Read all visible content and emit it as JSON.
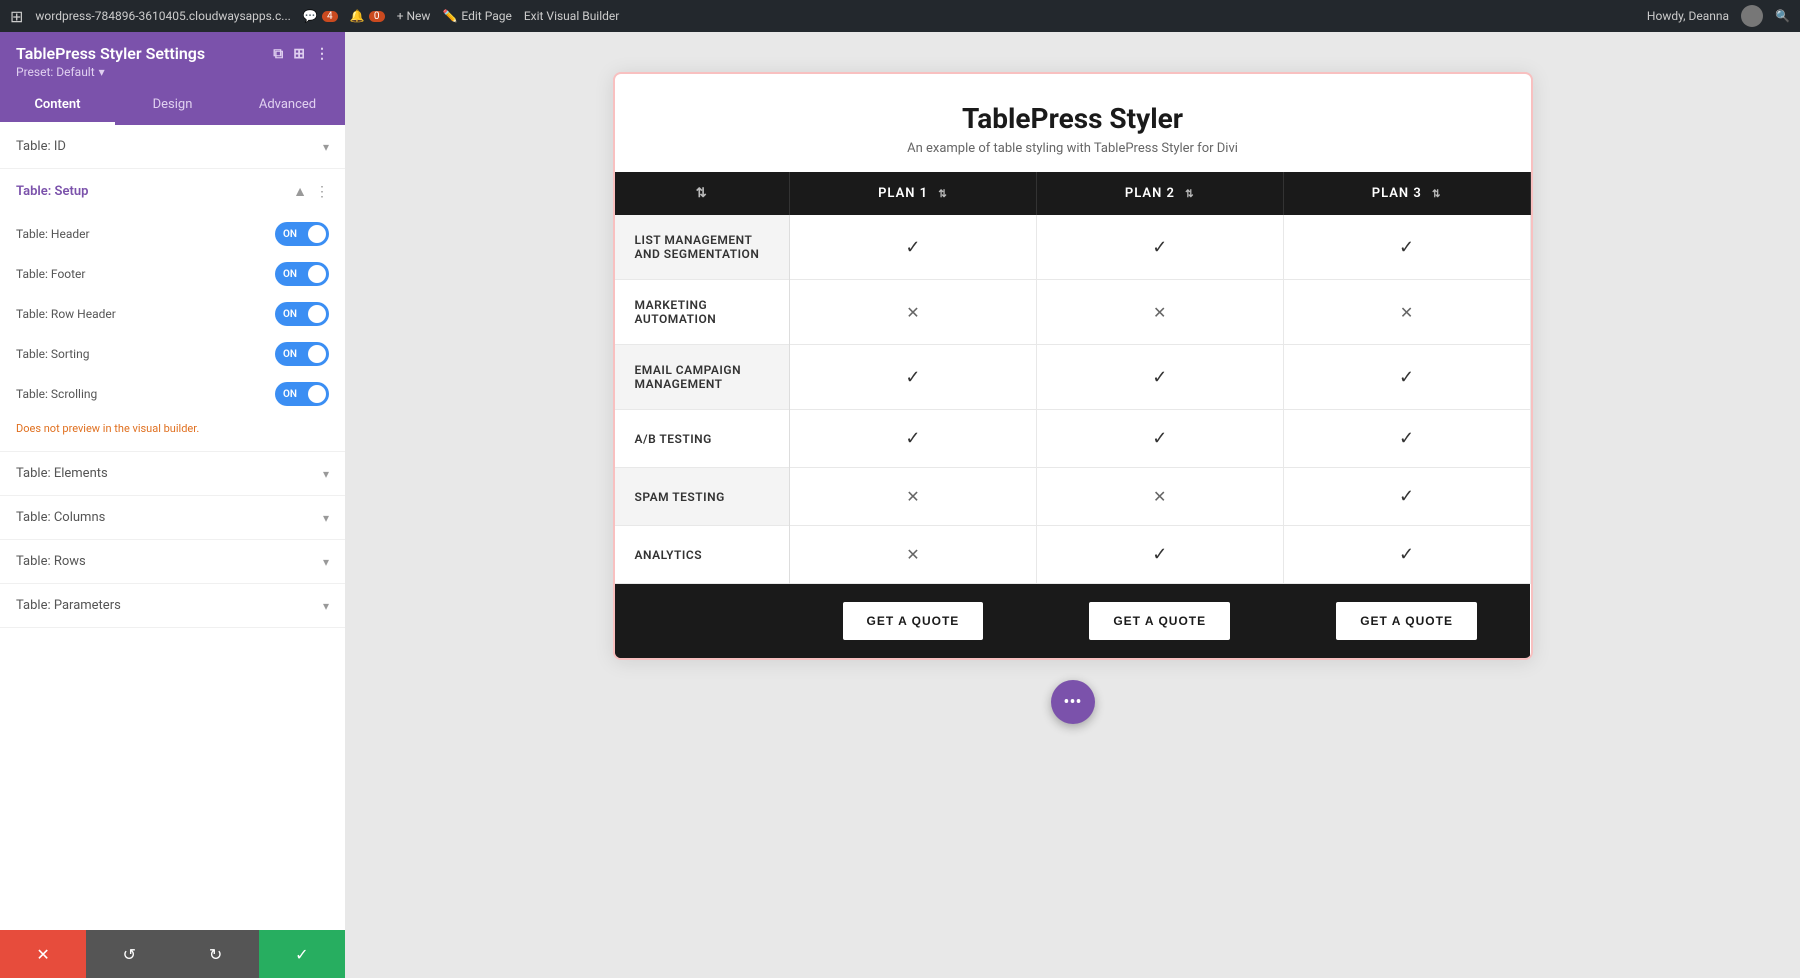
{
  "admin_bar": {
    "wp_logo": "⊞",
    "url": "wordpress-784896-3610405.cloudwaysapps.c...",
    "comments_count": "4",
    "notifications_count": "0",
    "new_label": "+ New",
    "edit_page_label": "Edit Page",
    "exit_builder_label": "Exit Visual Builder",
    "user_label": "Howdy, Deanna",
    "search_icon": "🔍"
  },
  "sidebar": {
    "title": "TablePress Styler Settings",
    "preset_label": "Preset: Default",
    "preset_chevron": "▾",
    "icons": {
      "copy": "⧉",
      "grid": "⊞",
      "menu": "⋮"
    },
    "tabs": [
      {
        "id": "content",
        "label": "Content",
        "active": true
      },
      {
        "id": "design",
        "label": "Design",
        "active": false
      },
      {
        "id": "advanced",
        "label": "Advanced",
        "active": false
      }
    ],
    "sections": [
      {
        "id": "table-id",
        "label": "Table: ID",
        "expanded": false,
        "purple": false
      },
      {
        "id": "table-setup",
        "label": "Table: Setup",
        "expanded": true,
        "purple": true,
        "toggles": [
          {
            "id": "table-header",
            "label": "Table: Header",
            "on": true
          },
          {
            "id": "table-footer",
            "label": "Table: Footer",
            "on": true
          },
          {
            "id": "table-row-header",
            "label": "Table: Row Header",
            "on": true
          },
          {
            "id": "table-sorting",
            "label": "Table: Sorting",
            "on": true
          },
          {
            "id": "table-scrolling",
            "label": "Table: Scrolling",
            "on": true
          }
        ],
        "warning": "Does not preview in the visual builder."
      },
      {
        "id": "table-elements",
        "label": "Table: Elements",
        "expanded": false,
        "purple": false
      },
      {
        "id": "table-columns",
        "label": "Table: Columns",
        "expanded": false,
        "purple": false
      },
      {
        "id": "table-rows",
        "label": "Table: Rows",
        "expanded": false,
        "purple": false
      },
      {
        "id": "table-parameters",
        "label": "Table: Parameters",
        "expanded": false,
        "purple": false
      }
    ]
  },
  "action_bar": {
    "close_icon": "✕",
    "undo_icon": "↺",
    "redo_icon": "↻",
    "save_icon": "✓"
  },
  "main_content": {
    "table_title": "TablePress Styler",
    "table_subtitle": "An example of table styling with TablePress Styler for Divi",
    "table": {
      "headers": [
        {
          "label": "",
          "sort": true
        },
        {
          "label": "PLAN 1",
          "sort": true
        },
        {
          "label": "PLAN 2",
          "sort": true
        },
        {
          "label": "PLAN 3",
          "sort": true
        }
      ],
      "rows": [
        {
          "feature": "LIST MANAGEMENT AND SEGMENTATION",
          "plan1": "check",
          "plan2": "check",
          "plan3": "check"
        },
        {
          "feature": "MARKETING AUTOMATION",
          "plan1": "cross",
          "plan2": "cross",
          "plan3": "cross"
        },
        {
          "feature": "EMAIL CAMPAIGN MANAGEMENT",
          "plan1": "check",
          "plan2": "check",
          "plan3": "check"
        },
        {
          "feature": "A/B TESTING",
          "plan1": "check",
          "plan2": "check",
          "plan3": "check"
        },
        {
          "feature": "SPAM TESTING",
          "plan1": "cross",
          "plan2": "cross",
          "plan3": "check"
        },
        {
          "feature": "ANALYTICS",
          "plan1": "cross",
          "plan2": "check",
          "plan3": "check"
        }
      ],
      "footer_button": "GET A QUOTE"
    },
    "fab_label": "•••",
    "toggle_on_label": "ON"
  }
}
